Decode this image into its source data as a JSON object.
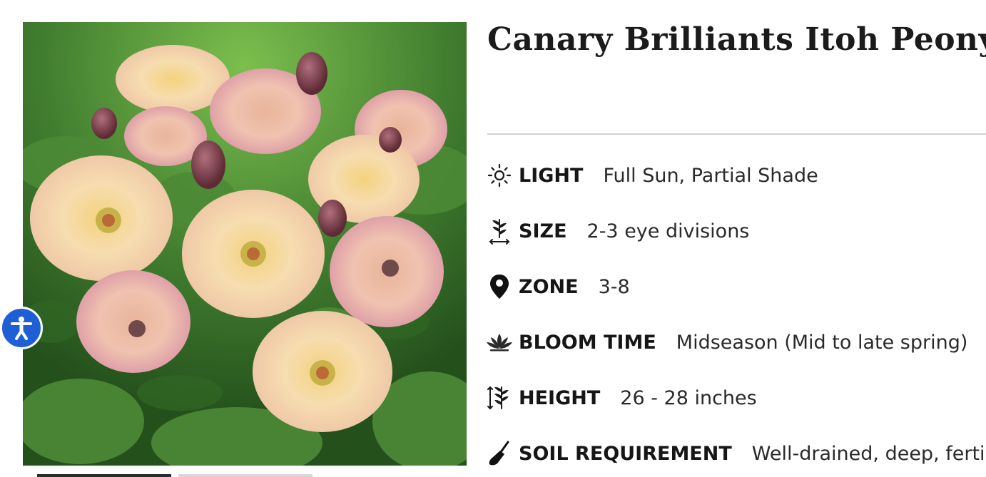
{
  "product": {
    "title": "Canary Brilliants Itoh Peony",
    "image_alt": "Canary Brilliants Itoh Peony blooms"
  },
  "attributes": [
    {
      "icon": "sun-icon",
      "label": "LIGHT",
      "value": "Full Sun, Partial Shade"
    },
    {
      "icon": "plant-size-icon",
      "label": "SIZE",
      "value": "2-3 eye divisions"
    },
    {
      "icon": "location-pin-icon",
      "label": "ZONE",
      "value": "3-8"
    },
    {
      "icon": "lotus-icon",
      "label": "BLOOM TIME",
      "value": "Midseason (Mid to late spring)"
    },
    {
      "icon": "plant-height-icon",
      "label": "HEIGHT",
      "value": "26 - 28 inches"
    },
    {
      "icon": "trowel-icon",
      "label": "SOIL REQUIREMENT",
      "value": "Well-drained, deep, fertil"
    }
  ],
  "accessibility": {
    "icon": "accessibility-icon",
    "label": "Accessibility"
  },
  "colors": {
    "accent": "#1e5fd6",
    "divider": "#cfcfcf",
    "foliage": "#3f7a2e",
    "petal_cream": "#f6d9a4",
    "petal_pink": "#eab3a3",
    "bud": "#7a3b48"
  }
}
